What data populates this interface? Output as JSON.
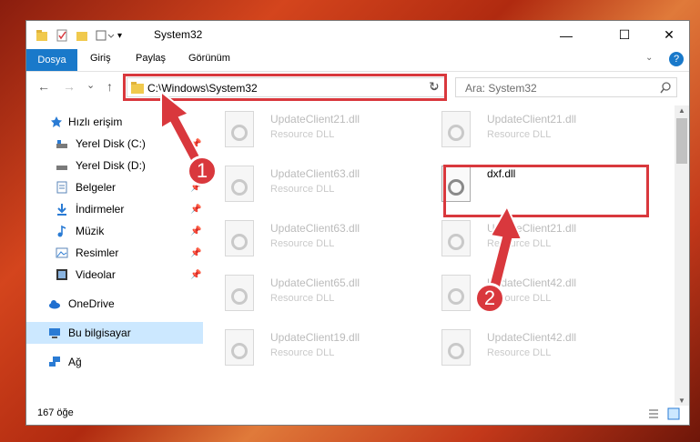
{
  "window": {
    "title": "System32",
    "controls": {
      "minimize": "—",
      "maximize": "☐",
      "close": "✕"
    }
  },
  "ribbon": {
    "tabs": [
      "Dosya",
      "Giriş",
      "Paylaş",
      "Görünüm"
    ],
    "help": "?"
  },
  "nav": {
    "back": "←",
    "forward": "→",
    "recent": "⌄",
    "up": "↑",
    "address": "C:\\Windows\\System32",
    "refresh": "↻",
    "search_placeholder": "Ara: System32"
  },
  "sidebar": {
    "items": [
      {
        "label": "Hızlı erişim",
        "icon": "star-icon"
      },
      {
        "label": "Yerel Disk (C:)",
        "icon": "drive-icon"
      },
      {
        "label": "Yerel Disk (D:)",
        "icon": "drive-icon"
      },
      {
        "label": "Belgeler",
        "icon": "documents-icon"
      },
      {
        "label": "İndirmeler",
        "icon": "downloads-icon"
      },
      {
        "label": "Müzik",
        "icon": "music-icon"
      },
      {
        "label": "Resimler",
        "icon": "pictures-icon"
      },
      {
        "label": "Videolar",
        "icon": "videos-icon"
      },
      {
        "label": "OneDrive",
        "icon": "cloud-icon"
      },
      {
        "label": "Bu bilgisayar",
        "icon": "computer-icon"
      },
      {
        "label": "Ağ",
        "icon": "network-icon"
      }
    ]
  },
  "files": [
    {
      "name": "UpdateClient21.dll",
      "desc": "Resource DLL"
    },
    {
      "name": "UpdateClient21.dll",
      "desc": "Resource DLL"
    },
    {
      "name": "UpdateClient63.dll",
      "desc": "Resource DLL"
    },
    {
      "name": "dxf.dll",
      "desc": ""
    },
    {
      "name": "UpdateClient63.dll",
      "desc": "Resource DLL"
    },
    {
      "name": "UpdateClient21.dll",
      "desc": "Resource DLL"
    },
    {
      "name": "UpdateClient65.dll",
      "desc": "Resource DLL"
    },
    {
      "name": "UpdateClient42.dll",
      "desc": "Resource DLL"
    },
    {
      "name": "UpdateClient19.dll",
      "desc": "Resource DLL"
    },
    {
      "name": "UpdateClient42.dll",
      "desc": "Resource DLL"
    }
  ],
  "status": {
    "count": "167 öğe"
  },
  "annotations": {
    "step1": "1",
    "step2": "2",
    "color": "#d9383d"
  }
}
